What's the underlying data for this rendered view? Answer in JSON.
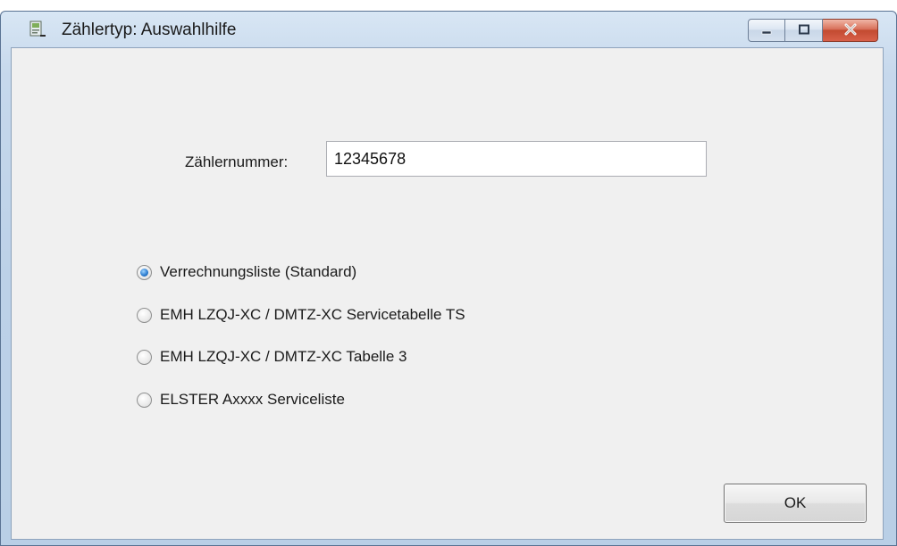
{
  "window": {
    "title": "Zählertyp: Auswahlhilfe",
    "icon": "document-icon",
    "caption_buttons": [
      "minimize-icon",
      "maximize-icon",
      "close-icon"
    ]
  },
  "form": {
    "meter_number_label": "Zählernummer:",
    "meter_number_value": "12345678"
  },
  "options": [
    {
      "label": "Verrechnungsliste (Standard)",
      "checked": true
    },
    {
      "label": "EMH LZQJ-XC / DMTZ-XC Servicetabelle TS",
      "checked": false
    },
    {
      "label": "EMH LZQJ-XC / DMTZ-XC Tabelle 3",
      "checked": false
    },
    {
      "label": "ELSTER Axxxx Serviceliste",
      "checked": false
    }
  ],
  "buttons": {
    "ok_label": "OK"
  },
  "colors": {
    "client_bg": "#f0f0f0",
    "frame": "#bcd1e8",
    "radio_selected": "#2f7fd1",
    "close_button": "#c24a30"
  }
}
